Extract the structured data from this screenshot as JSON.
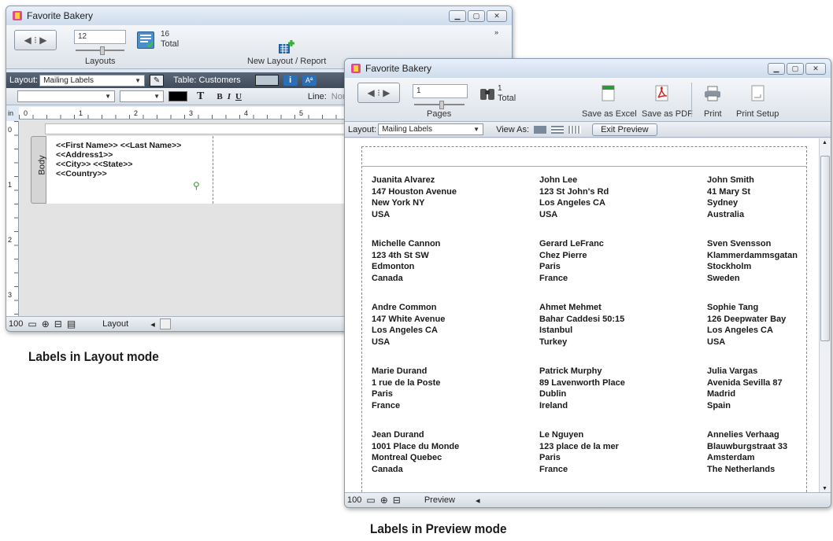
{
  "layout_window": {
    "title": "Favorite Bakery",
    "record_value": "12",
    "total_count": "16",
    "total_label": "Total",
    "layouts_label": "Layouts",
    "new_layout_label": "New Layout / Report",
    "layout_prefix": "Layout:",
    "layout_select": "Mailing Labels",
    "table_label": "Table: Customers",
    "line_label": "Line:",
    "line_value": "Non",
    "ruler_units": "in",
    "ruler_marks": [
      "0",
      "1",
      "2",
      "3",
      "4",
      "5"
    ],
    "vruler_marks": [
      "0",
      "1",
      "2",
      "3"
    ],
    "part_label": "Body",
    "fields": [
      "<<First Name>> <<Last Name>>",
      "<<Address1>>",
      "<<City>> <<State>>",
      "<<Country>>"
    ],
    "zoom": "100",
    "mode": "Layout",
    "text_tool": "T",
    "bold": "B",
    "italic": "I",
    "underline": "U"
  },
  "preview_window": {
    "title": "Favorite Bakery",
    "page_value": "1",
    "total_count": "1",
    "total_label": "Total",
    "pages_label": "Pages",
    "save_excel": "Save as Excel",
    "save_pdf": "Save as PDF",
    "print": "Print",
    "print_setup": "Print Setup",
    "layout_prefix": "Layout:",
    "layout_select": "Mailing Labels",
    "view_as": "View As:",
    "exit_preview": "Exit Preview",
    "zoom": "100",
    "mode": "Preview",
    "labels": [
      [
        "Juanita Alvarez",
        "147 Houston Avenue",
        "New York NY",
        "USA"
      ],
      [
        "John Lee",
        "123 St John's Rd",
        "Los Angeles CA",
        "USA"
      ],
      [
        "John  Smith",
        "41 Mary St",
        "Sydney",
        "Australia"
      ],
      [
        "Michelle Cannon",
        "123 4th St SW",
        "Edmonton",
        "Canada"
      ],
      [
        "Gerard LeFranc",
        "Chez Pierre",
        "Paris",
        "France"
      ],
      [
        "Sven Svensson",
        "Klammerdammsgatan",
        "Stockholm",
        "Sweden"
      ],
      [
        "Andre Common",
        "147 White Avenue",
        "Los Angeles CA",
        "USA"
      ],
      [
        "Ahmet Mehmet",
        "Bahar Caddesi 50:15",
        "Istanbul",
        "Turkey"
      ],
      [
        "Sophie Tang",
        "126 Deepwater Bay",
        "Los Angeles CA",
        "USA"
      ],
      [
        "Marie Durand",
        "1 rue de la Poste",
        "Paris",
        "France"
      ],
      [
        "Patrick Murphy",
        "89 Lavenworth Place",
        "Dublin",
        "Ireland"
      ],
      [
        "Julia Vargas",
        "Avenida Sevilla 87",
        "Madrid",
        "Spain"
      ],
      [
        "Jean Durand",
        "1001 Place du Monde",
        "Montreal Quebec",
        "Canada"
      ],
      [
        "Le Nguyen",
        "123 place de la mer",
        "Paris",
        "France"
      ],
      [
        "Annelies Verhaag",
        "Blauwburgstraat 33",
        "Amsterdam",
        "The Netherlands"
      ]
    ]
  },
  "captions": {
    "layout_mode": "Labels in Layout mode",
    "preview_mode": "Labels in Preview mode"
  }
}
